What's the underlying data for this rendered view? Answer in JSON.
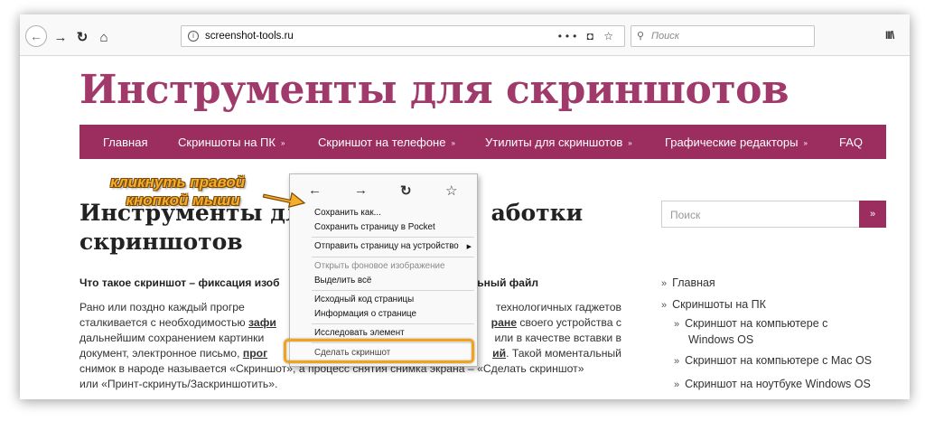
{
  "browser": {
    "url": "screenshot-tools.ru",
    "url_actions": "••• ◘ ☆",
    "search_placeholder": "Поиск"
  },
  "site": {
    "title": "Инструменты для скриншотов",
    "nav": [
      {
        "label": "Главная",
        "has_caret": false
      },
      {
        "label": "Скриншоты на ПК",
        "has_caret": true
      },
      {
        "label": "Скриншот на телефоне",
        "has_caret": true
      },
      {
        "label": "Утилиты для скриншотов",
        "has_caret": true
      },
      {
        "label": "Графические редакторы",
        "has_caret": true
      },
      {
        "label": "FAQ",
        "has_caret": false
      }
    ],
    "caret": "»",
    "accent_color": "#9b2e5f"
  },
  "article": {
    "title_line1_left": "Инструменты дл",
    "title_line1_right": "аботки",
    "title_line2": "скриншотов",
    "subhead_left": "Что такое скриншот – фиксация изоб",
    "subhead_right": "отдельный файл",
    "para_lines": [
      {
        "left": "Рано   или   поздно   каждый   прогре",
        "right": "технологичных   гаджетов"
      },
      {
        "left": "сталкивается с необходимостью ",
        "left_bold": "зафи",
        "right_bold": "ране",
        "right": " своего устройства с"
      },
      {
        "left": "дальнейшим сохранением картинки",
        "right": "или в качестве вставки в"
      },
      {
        "left": "документ, электронное письмо, ",
        "left_bold": "прог",
        "right_bold": "ий",
        "right": ".  Такой моментальный"
      },
      {
        "left": "снимок в народе называется «Скриншот», а процесс снятия снимка экрана – «Сделать скриншот»"
      },
      {
        "left": "или «Принт-скринуть/Заскриншотить»."
      }
    ]
  },
  "sidebar": {
    "search_placeholder": "Поиск",
    "search_button": "»",
    "menu": [
      {
        "label": "Главная"
      },
      {
        "label": "Скриншоты на ПК"
      },
      {
        "label": "Скриншот на компьютере с",
        "label2": "Windows OS"
      },
      {
        "label": "Скриншот на компьютере с Mac OS"
      },
      {
        "label": "Скриншот на ноутбуке Windows OS"
      }
    ],
    "arrow": "»"
  },
  "context_menu": {
    "items": [
      {
        "label": "Сохранить как...",
        "disabled": false
      },
      {
        "label": "Сохранить страницу в Pocket",
        "disabled": false
      },
      {
        "label": "Отправить страницу на устройство",
        "disabled": false,
        "submenu": true
      },
      {
        "label": "Открыть фоновое изображение",
        "disabled": true
      },
      {
        "label": "Выделить всё",
        "disabled": false
      },
      {
        "label": "Исходный код страницы",
        "disabled": false
      },
      {
        "label": "Информация о странице",
        "disabled": false
      },
      {
        "label": "Исследовать элемент",
        "disabled": false
      },
      {
        "label": "Сделать скриншот",
        "disabled": false,
        "highlighted": true
      }
    ],
    "highlight_color": "#f0a41c"
  },
  "annotation": {
    "line1": "кликнуть правой",
    "line2": "кнопкой мыши",
    "color": "#f6ad2a"
  }
}
